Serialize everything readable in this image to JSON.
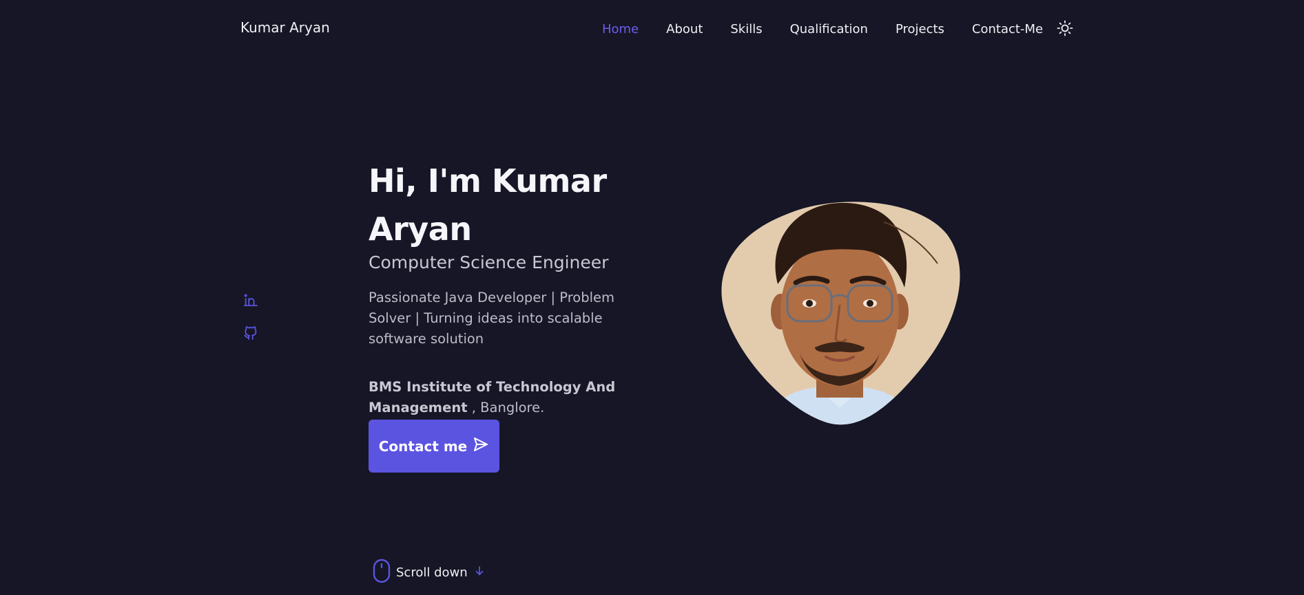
{
  "header": {
    "logo": "Kumar Aryan",
    "nav": [
      {
        "label": "Home",
        "active": true
      },
      {
        "label": "About",
        "active": false
      },
      {
        "label": "Skills",
        "active": false
      },
      {
        "label": "Qualification",
        "active": false
      },
      {
        "label": "Projects",
        "active": false
      },
      {
        "label": "Contact-Me",
        "active": false
      }
    ],
    "theme_icon": "sun-icon"
  },
  "social": [
    {
      "icon": "linkedin-icon"
    },
    {
      "icon": "github-icon"
    }
  ],
  "hero": {
    "title": "Hi, I'm Kumar Aryan",
    "subtitle": "Computer Science Engineer",
    "description": "Passionate Java Developer | Problem Solver | Turning ideas into scalable software solution",
    "institution_bold": "BMS Institute of Technology And Management",
    "institution_rest": " , Banglore.",
    "contact_label": "Contact me",
    "contact_icon": "send-icon"
  },
  "scroll": {
    "label": "Scroll down",
    "mouse_icon": "mouse-icon",
    "arrow_icon": "arrow-down-icon"
  },
  "colors": {
    "background": "#161626",
    "accent": "#5b54e0",
    "accent_text": "#6a5ef0",
    "text": "#f0f0f5",
    "muted": "#bdbdca"
  }
}
